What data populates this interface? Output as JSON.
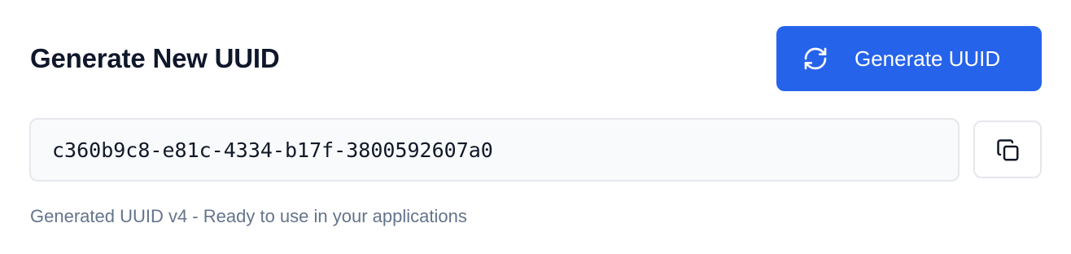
{
  "header": {
    "title": "Generate New UUID"
  },
  "generate_button": {
    "label": "Generate UUID",
    "icon": "refresh-icon",
    "color": "#2563eb"
  },
  "uuid_field": {
    "value": "c360b9c8-e81c-4334-b17f-3800592607a0"
  },
  "copy_button": {
    "icon": "copy-icon"
  },
  "caption": {
    "text": "Generated UUID v4 - Ready to use in your applications"
  }
}
